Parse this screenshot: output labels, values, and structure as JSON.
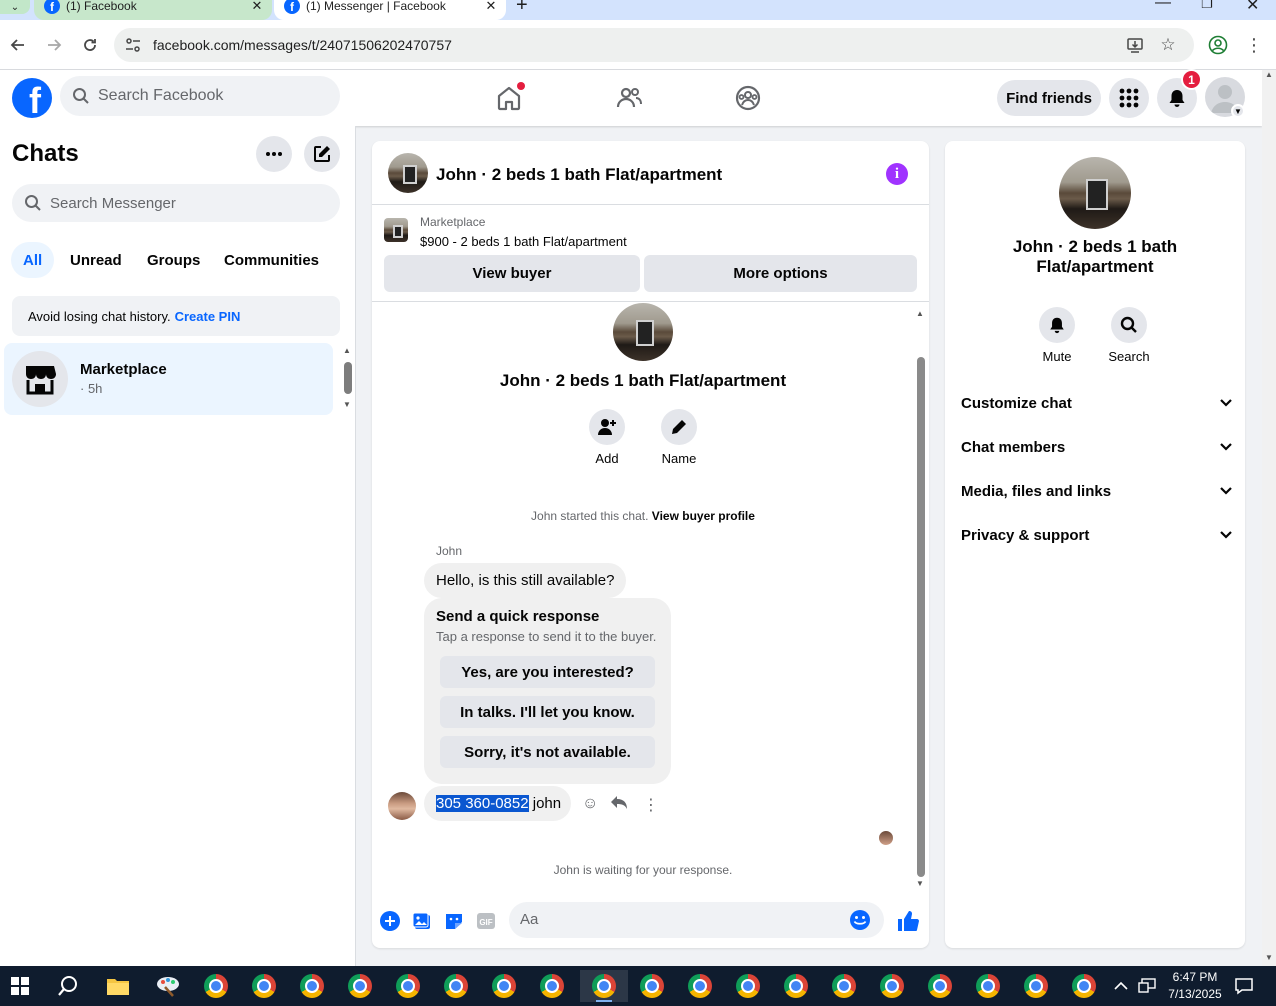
{
  "browser": {
    "tabs": [
      {
        "title": "(1) Facebook",
        "active": false
      },
      {
        "title": "(1) Messenger | Facebook",
        "active": true
      }
    ],
    "url": "facebook.com/messages/t/24071506202470757"
  },
  "fb_header": {
    "search_placeholder": "Search Facebook",
    "find_friends_label": "Find friends",
    "notification_count": "1"
  },
  "chats": {
    "title": "Chats",
    "search_placeholder": "Search Messenger",
    "filters": [
      "All",
      "Unread",
      "Groups",
      "Communities"
    ],
    "active_filter": "All",
    "pin_notice": "Avoid losing chat history.",
    "pin_link": "Create PIN",
    "items": [
      {
        "name": "Marketplace",
        "time": "· 5h"
      }
    ]
  },
  "conversation": {
    "title": "John · 2 beds 1 bath Flat/apartment",
    "marketplace_label": "Marketplace",
    "listing": "$900 - 2 beds 1 bath Flat/apartment",
    "view_buyer_label": "View buyer",
    "more_options_label": "More options",
    "hero_title": "John · 2 beds 1 bath Flat/apartment",
    "actions": [
      {
        "label": "Add",
        "icon": "add-person-icon"
      },
      {
        "label": "Name",
        "icon": "pencil-icon"
      }
    ],
    "started_text": "John started this chat.",
    "view_profile_link": "View buyer profile",
    "sender_name": "John",
    "incoming_message": "Hello, is this still available?",
    "quick_response": {
      "title": "Send a quick response",
      "subtitle": "Tap a response to send it to the buyer.",
      "options": [
        "Yes, are you interested?",
        "In talks. I'll let you know.",
        "Sorry, it's not available."
      ]
    },
    "last_message_selected": "305 360-0852",
    "last_message_rest": " john",
    "waiting_text": "John is waiting for your response.",
    "composer_placeholder": "Aa"
  },
  "details": {
    "title": "John · 2 beds 1 bath Flat/apartment",
    "actions": [
      {
        "label": "Mute",
        "icon": "bell-icon"
      },
      {
        "label": "Search",
        "icon": "search-icon"
      }
    ],
    "sections": [
      "Customize chat",
      "Chat members",
      "Media, files and links",
      "Privacy & support"
    ]
  },
  "taskbar": {
    "time": "6:47 PM",
    "date": "7/13/2025"
  },
  "colors": {
    "fb_blue": "#0866ff",
    "selected_filter_bg": "#ebf5ff",
    "info_purple": "#a033ff",
    "badge_red": "#e41e3f",
    "text_selection": "#0b57d0"
  }
}
